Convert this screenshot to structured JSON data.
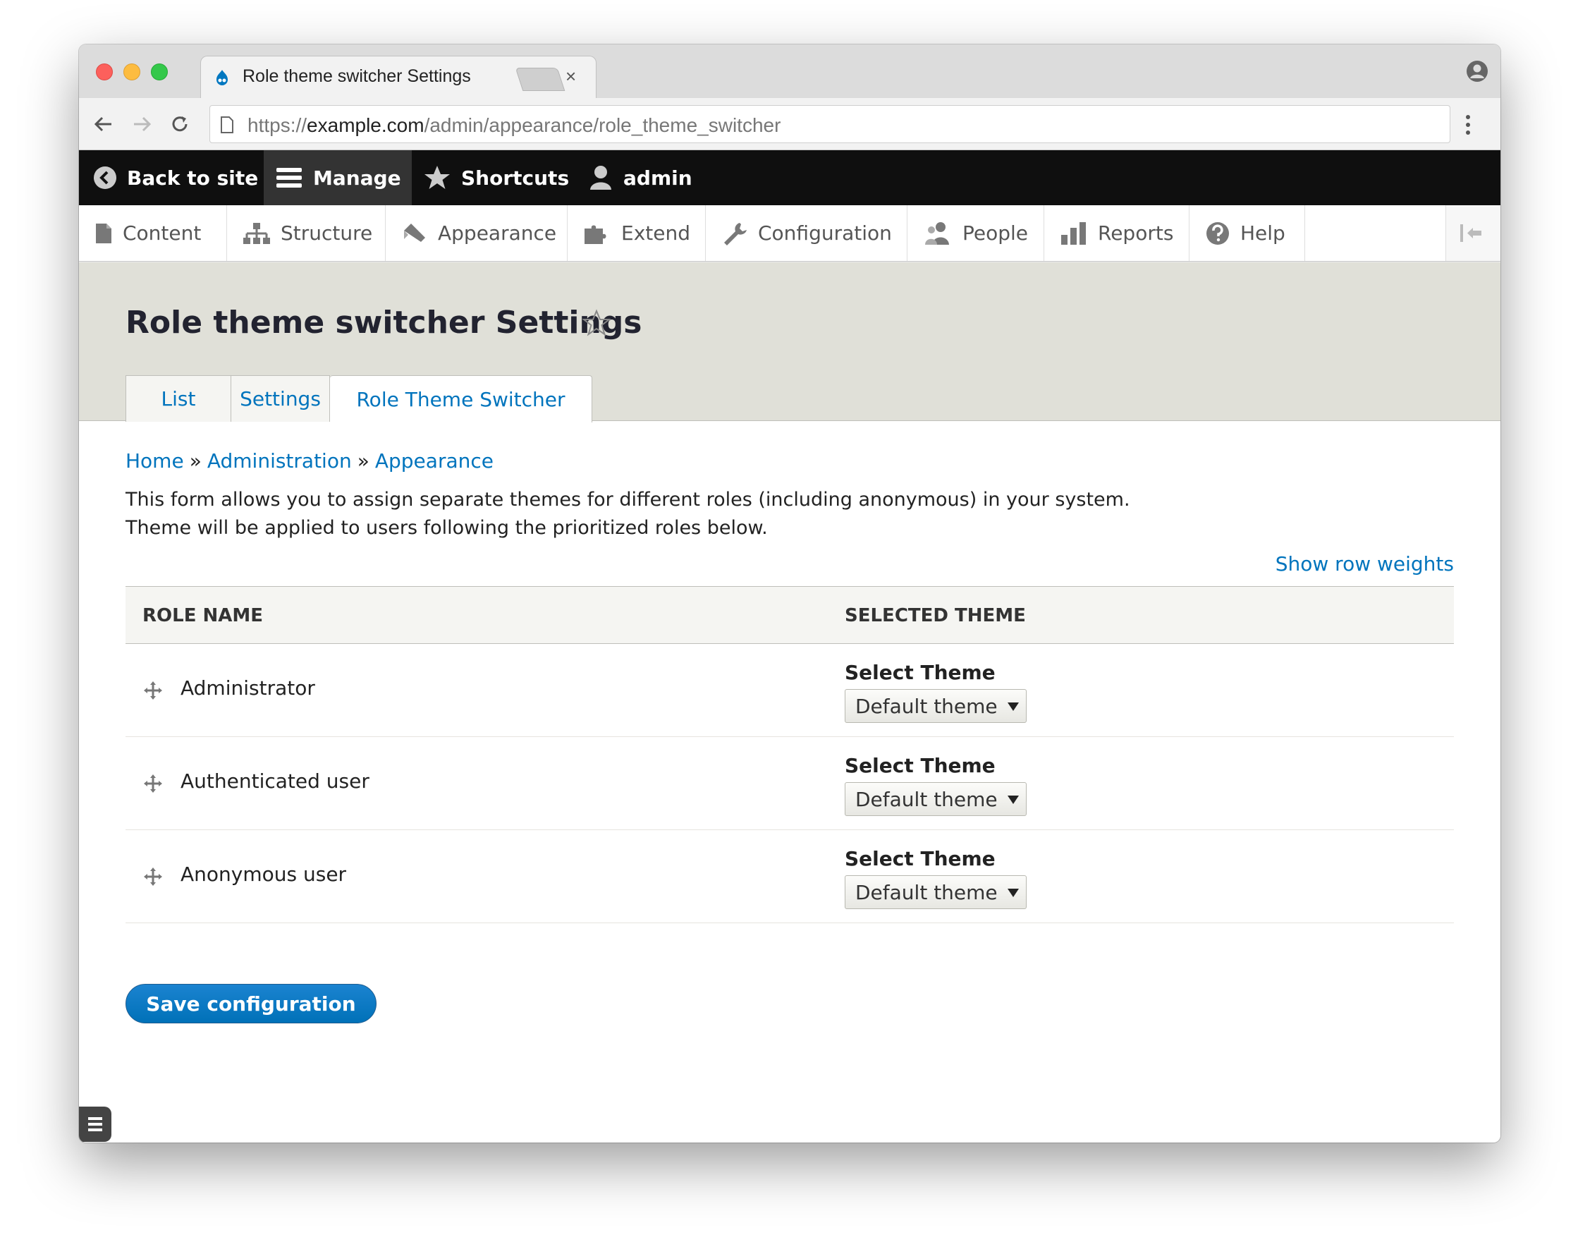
{
  "browser": {
    "tab_title": "Role theme switcher Settings",
    "tab_close": "×",
    "url_scheme": "https://",
    "url_host": "example.com",
    "url_path": "/admin/appearance/role_theme_switcher"
  },
  "toolbar": {
    "back_to_site": "Back to site",
    "manage": "Manage",
    "shortcuts": "Shortcuts",
    "user": "admin"
  },
  "tray": {
    "items": [
      {
        "label": "Content",
        "icon": "content-icon"
      },
      {
        "label": "Structure",
        "icon": "structure-icon"
      },
      {
        "label": "Appearance",
        "icon": "appearance-icon"
      },
      {
        "label": "Extend",
        "icon": "extend-icon"
      },
      {
        "label": "Configuration",
        "icon": "configuration-icon"
      },
      {
        "label": "People",
        "icon": "people-icon"
      },
      {
        "label": "Reports",
        "icon": "reports-icon"
      },
      {
        "label": "Help",
        "icon": "help-icon"
      }
    ]
  },
  "page": {
    "title": "Role theme switcher Settings",
    "tabs": [
      {
        "label": "List",
        "active": false
      },
      {
        "label": "Settings",
        "active": false
      },
      {
        "label": "Role Theme Switcher",
        "active": true
      }
    ]
  },
  "breadcrumb": {
    "items": [
      "Home",
      "Administration",
      "Appearance"
    ],
    "separator": "»"
  },
  "description": {
    "line1": "This form allows you to assign separate themes for different roles (including anonymous) in your system.",
    "line2": "Theme will be applied to users following the prioritized roles below."
  },
  "table": {
    "show_row_weights": "Show row weights",
    "headers": {
      "role": "Role name",
      "theme": "Selected theme"
    },
    "rows": [
      {
        "role": "Administrator",
        "select_label": "Select Theme",
        "value": "Default theme"
      },
      {
        "role": "Authenticated user",
        "select_label": "Select Theme",
        "value": "Default theme"
      },
      {
        "role": "Anonymous user",
        "select_label": "Select Theme",
        "value": "Default theme"
      }
    ]
  },
  "actions": {
    "save": "Save configuration"
  },
  "colors": {
    "link": "#0074bd",
    "primary_button": "#0071b8",
    "toolbar_bg": "#0f0f0f",
    "header_bg": "#e0e0d8"
  }
}
